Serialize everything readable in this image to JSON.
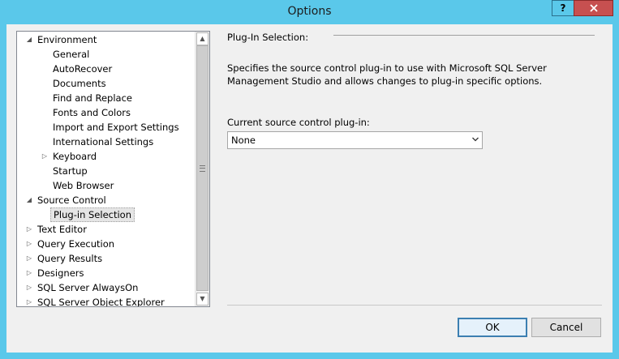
{
  "window": {
    "title": "Options",
    "help_label": "?",
    "close_label": "X"
  },
  "tree": {
    "items": [
      {
        "label": "Environment",
        "level": 0,
        "arrow": "◢"
      },
      {
        "label": "General",
        "level": 1,
        "arrow": ""
      },
      {
        "label": "AutoRecover",
        "level": 1,
        "arrow": ""
      },
      {
        "label": "Documents",
        "level": 1,
        "arrow": ""
      },
      {
        "label": "Find and Replace",
        "level": 1,
        "arrow": ""
      },
      {
        "label": "Fonts and Colors",
        "level": 1,
        "arrow": ""
      },
      {
        "label": "Import and Export Settings",
        "level": 1,
        "arrow": ""
      },
      {
        "label": "International Settings",
        "level": 1,
        "arrow": ""
      },
      {
        "label": "Keyboard",
        "level": 1,
        "arrow": "▷"
      },
      {
        "label": "Startup",
        "level": 1,
        "arrow": ""
      },
      {
        "label": "Web Browser",
        "level": 1,
        "arrow": ""
      },
      {
        "label": "Source Control",
        "level": 0,
        "arrow": "◢"
      },
      {
        "label": "Plug-in Selection",
        "level": 1,
        "arrow": "",
        "selected": true
      },
      {
        "label": "Text Editor",
        "level": 0,
        "arrow": "▷"
      },
      {
        "label": "Query Execution",
        "level": 0,
        "arrow": "▷"
      },
      {
        "label": "Query Results",
        "level": 0,
        "arrow": "▷"
      },
      {
        "label": "Designers",
        "level": 0,
        "arrow": "▷"
      },
      {
        "label": "SQL Server AlwaysOn",
        "level": 0,
        "arrow": "▷"
      },
      {
        "label": "SQL Server Object Explorer",
        "level": 0,
        "arrow": "▷"
      }
    ],
    "scroll_up": "▲",
    "scroll_down": "▼"
  },
  "panel": {
    "heading": "Plug-In Selection:",
    "description": "Specifies the source control plug-in to use with Microsoft SQL Server Management Studio and allows changes to plug-in specific options.",
    "combo_label": "Current source control plug-in:",
    "combo_value": "None"
  },
  "buttons": {
    "ok": "OK",
    "cancel": "Cancel"
  },
  "colors": {
    "titlebar": "#5ac8ea",
    "close": "#c75050",
    "ok_border": "#3c7fb1"
  }
}
